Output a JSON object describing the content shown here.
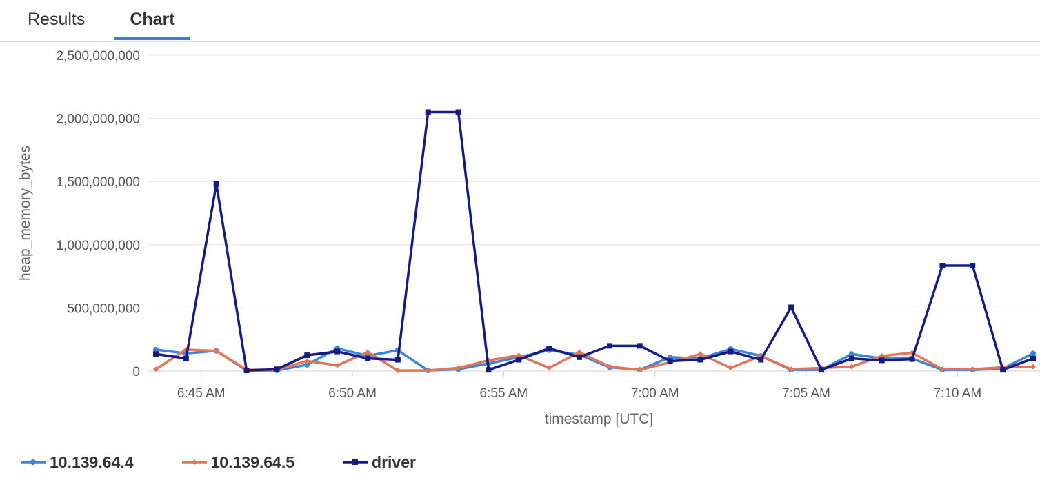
{
  "tabs": [
    {
      "label": "Results"
    },
    {
      "label": "Chart"
    }
  ],
  "chart_data": {
    "type": "line",
    "xlabel": "timestamp [UTC]",
    "ylabel": "heap_memory_bytes",
    "ylim": [
      0,
      2500000000
    ],
    "yticks": [
      0,
      500000000,
      1000000000,
      1500000000,
      2000000000,
      2500000000
    ],
    "ytick_labels": [
      "0",
      "500,000,000",
      "1,000,000,000",
      "1,500,000,000",
      "2,000,000,000",
      "2,500,000,000"
    ],
    "xlim": [
      "6:43:15",
      "7:12:30"
    ],
    "xticks": [
      "6:45 AM",
      "6:50 AM",
      "6:55 AM",
      "7:00 AM",
      "7:05 AM",
      "7:10 AM"
    ],
    "grid": true,
    "legend_position": "bottom-left",
    "series": [
      {
        "name": "10.139.64.4",
        "color": "#3d85d6",
        "marker": "circle",
        "points": [
          [
            "6:43:30",
            170000000
          ],
          [
            "6:44:30",
            140000000
          ],
          [
            "6:45:30",
            160000000
          ],
          [
            "6:46:30",
            5000000
          ],
          [
            "6:47:30",
            5000000
          ],
          [
            "6:48:30",
            50000000
          ],
          [
            "6:49:30",
            180000000
          ],
          [
            "6:50:30",
            120000000
          ],
          [
            "6:51:30",
            165000000
          ],
          [
            "6:52:30",
            5000000
          ],
          [
            "6:53:30",
            15000000
          ],
          [
            "6:54:30",
            60000000
          ],
          [
            "6:55:30",
            110000000
          ],
          [
            "6:56:30",
            165000000
          ],
          [
            "6:57:30",
            130000000
          ],
          [
            "6:58:30",
            30000000
          ],
          [
            "6:59:30",
            10000000
          ],
          [
            "7:00:30",
            110000000
          ],
          [
            "7:01:30",
            100000000
          ],
          [
            "7:02:30",
            175000000
          ],
          [
            "7:03:30",
            120000000
          ],
          [
            "7:04:30",
            10000000
          ],
          [
            "7:05:30",
            10000000
          ],
          [
            "7:06:30",
            135000000
          ],
          [
            "7:07:30",
            100000000
          ],
          [
            "7:08:30",
            100000000
          ],
          [
            "7:09:30",
            10000000
          ],
          [
            "7:10:30",
            10000000
          ],
          [
            "7:11:30",
            20000000
          ],
          [
            "7:12:30",
            140000000
          ]
        ]
      },
      {
        "name": "10.139.64.5",
        "color": "#e27558",
        "marker": "diamond",
        "points": [
          [
            "6:43:30",
            15000000
          ],
          [
            "6:44:30",
            170000000
          ],
          [
            "6:45:30",
            160000000
          ],
          [
            "6:46:30",
            10000000
          ],
          [
            "6:47:30",
            10000000
          ],
          [
            "6:48:30",
            80000000
          ],
          [
            "6:49:30",
            45000000
          ],
          [
            "6:50:30",
            150000000
          ],
          [
            "6:51:30",
            5000000
          ],
          [
            "6:52:30",
            5000000
          ],
          [
            "6:53:30",
            25000000
          ],
          [
            "6:54:30",
            85000000
          ],
          [
            "6:55:30",
            125000000
          ],
          [
            "6:56:30",
            25000000
          ],
          [
            "6:57:30",
            150000000
          ],
          [
            "6:58:30",
            35000000
          ],
          [
            "6:59:30",
            10000000
          ],
          [
            "7:00:30",
            70000000
          ],
          [
            "7:01:30",
            135000000
          ],
          [
            "7:02:30",
            25000000
          ],
          [
            "7:03:30",
            120000000
          ],
          [
            "7:04:30",
            15000000
          ],
          [
            "7:05:30",
            25000000
          ],
          [
            "7:06:30",
            35000000
          ],
          [
            "7:07:30",
            120000000
          ],
          [
            "7:08:30",
            145000000
          ],
          [
            "7:09:30",
            15000000
          ],
          [
            "7:10:30",
            15000000
          ],
          [
            "7:11:30",
            30000000
          ],
          [
            "7:12:30",
            35000000
          ]
        ]
      },
      {
        "name": "driver",
        "color": "#141c84",
        "marker": "square",
        "points": [
          [
            "6:43:30",
            135000000
          ],
          [
            "6:44:30",
            100000000
          ],
          [
            "6:45:30",
            1480000000
          ],
          [
            "6:46:30",
            5000000
          ],
          [
            "6:47:30",
            15000000
          ],
          [
            "6:48:30",
            125000000
          ],
          [
            "6:49:30",
            155000000
          ],
          [
            "6:50:30",
            100000000
          ],
          [
            "6:51:30",
            90000000
          ],
          [
            "6:52:30",
            2050000000
          ],
          [
            "6:53:30",
            2050000000
          ],
          [
            "6:54:30",
            10000000
          ],
          [
            "6:55:30",
            90000000
          ],
          [
            "6:56:30",
            180000000
          ],
          [
            "6:57:30",
            110000000
          ],
          [
            "6:58:30",
            200000000
          ],
          [
            "6:59:30",
            200000000
          ],
          [
            "7:00:30",
            80000000
          ],
          [
            "7:01:30",
            90000000
          ],
          [
            "7:02:30",
            155000000
          ],
          [
            "7:03:30",
            90000000
          ],
          [
            "7:04:30",
            505000000
          ],
          [
            "7:05:30",
            10000000
          ],
          [
            "7:06:30",
            100000000
          ],
          [
            "7:07:30",
            85000000
          ],
          [
            "7:08:30",
            95000000
          ],
          [
            "7:09:30",
            835000000
          ],
          [
            "7:10:30",
            835000000
          ],
          [
            "7:11:30",
            10000000
          ],
          [
            "7:12:30",
            100000000
          ]
        ]
      }
    ]
  }
}
